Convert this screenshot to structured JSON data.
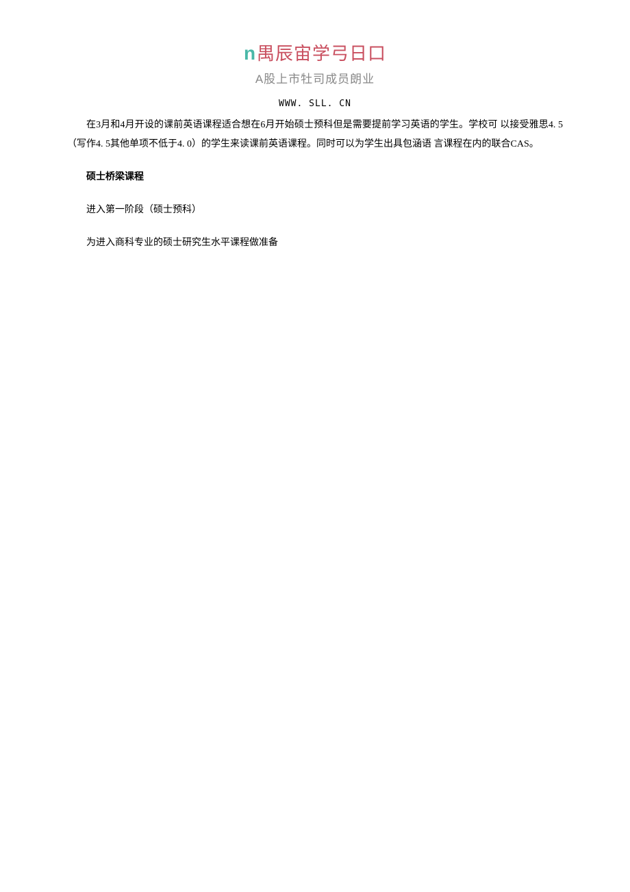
{
  "header": {
    "logo_prefix": "n",
    "logo_text": "禺辰宙学弓日口",
    "tagline": "A股上市牡司成员朗业"
  },
  "url": "WWW. SLL. CN",
  "body": {
    "para1": "在3月和4月开设的课前英语课程适合想在6月开始硕士预科但是需要提前学习英语的学生。学校可  以接受雅思4. 5  （写作4. 5其他单项不低于4. 0）的学生来读课前英语课程。同时可以为学生出具包涵语  言课程在内的联合CAS。",
    "section_title": "硕士桥梁课程",
    "para2": "进入第一阶段（硕士预科）",
    "para3": "为进入商科专业的硕士研究生水平课程做准备"
  }
}
